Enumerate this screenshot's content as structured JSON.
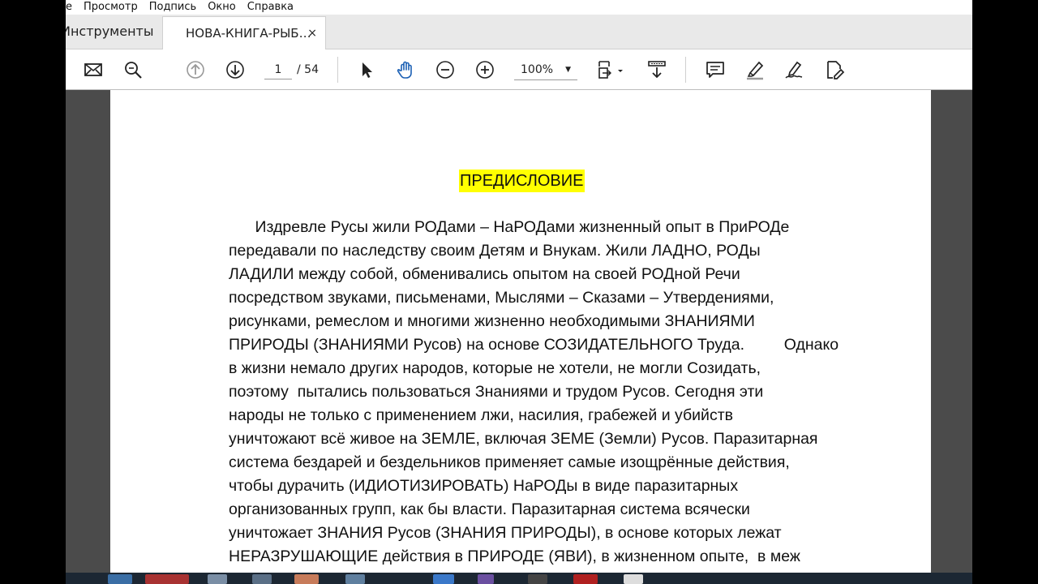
{
  "menu": [
    "Просмотр",
    "Подпись",
    "Окно",
    "Справка"
  ],
  "menu_partial": "e",
  "tabs": {
    "tools_label": "Инструменты",
    "doc_label": "НОВА-КНИГА-РЫБ…",
    "close_glyph": "×"
  },
  "toolbar": {
    "page_current": "1",
    "page_total": "/ 54",
    "zoom": "100%",
    "icons": [
      "envelope-icon",
      "search-icon",
      "page-up-icon",
      "page-down-icon",
      "select-cursor-icon",
      "hand-icon",
      "zoom-out-icon",
      "zoom-in-icon",
      "page-fit-icon",
      "scroll-icon",
      "comment-icon",
      "highlight-icon",
      "sign-icon",
      "edit-pdf-icon"
    ]
  },
  "document": {
    "heading": "ПРЕДИСЛОВИЕ",
    "lines": [
      "      Издревле Русы жили РОДами – НаРОДами жизненный опыт в ПриРОДе",
      "передавали по наследству своим Детям и Внукам. Жили ЛАДНО, РОДы",
      "ЛАДИЛИ между собой, обменивались опытом на своей РОДной Речи",
      "посредством звуками, письменами, Мыслями – Сказами – Утвердениями,",
      "рисунками, ремеслом и многими жизненно необходимыми ЗНАНИЯМИ",
      "ПРИРОДЫ (ЗНАНИЯМИ Русов) на основе СОЗИДАТЕЛЬНОГО Труда.         Однако",
      "в жизни немало других народов, которые не хотели, не могли Созидать,",
      "поэтому  пытались пользоваться Знаниями и трудом Русов. Сегодня эти",
      "народы не только с применением лжи, насилия, грабежей и убийств",
      "уничтожают всё живое на ЗЕМЛЕ, включая ЗЕМЕ (Земли) Русов. Паразитарная",
      "система бездарей и бездельников применяет самые изощрённые действия,",
      "чтобы дурачить (ИДИОТИЗИРОВАТЬ) НаРОДы в виде паразитарных",
      "организованных групп, как бы власти. Паразитарная система всячески",
      "уничтожает ЗНАНИЯ Русов (ЗНАНИЯ ПРИРОДЫ), в основе которых лежат",
      "НЕРАЗРУШАЮЩИЕ действия в ПРИРОДЕ (ЯВИ), в жизненном опыте,  в меж"
    ]
  },
  "colors": {
    "highlight": "#ffff00",
    "workspace": "#4b4b4b",
    "toolbar_bg": "#ffffff",
    "tabrow_bg": "#e9e9e9"
  }
}
